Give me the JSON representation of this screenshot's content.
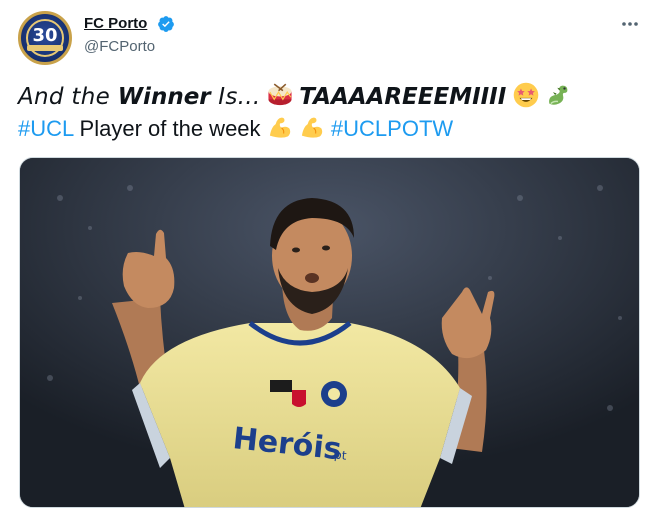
{
  "tweet": {
    "author": {
      "display_name": "FC Porto",
      "handle": "@FCPorto",
      "avatar_text": "30",
      "verified": true
    },
    "text": {
      "line1_part1": "And the ",
      "line1_bold": "Winner",
      "line1_part2": " Is...",
      "line1_shout": "TAAAAREEEMIIII",
      "hashtag_ucl": "#UCL",
      "line2_text": " Player of the week ",
      "hashtag_potw": "#UCLPOTW"
    },
    "emojis": [
      "drum-icon",
      "star-struck-icon",
      "dragon-icon",
      "flexed-biceps-icon",
      "flexed-biceps-icon"
    ],
    "media": {
      "shirt_sponsor": "Heróis",
      "shirt_sponsor_suffix": ".pt"
    }
  },
  "colors": {
    "link": "#1d9bf0",
    "verified": "#1d9bf0",
    "text": "#0f1419",
    "secondary": "#536471",
    "shirt": "#efe49a"
  }
}
